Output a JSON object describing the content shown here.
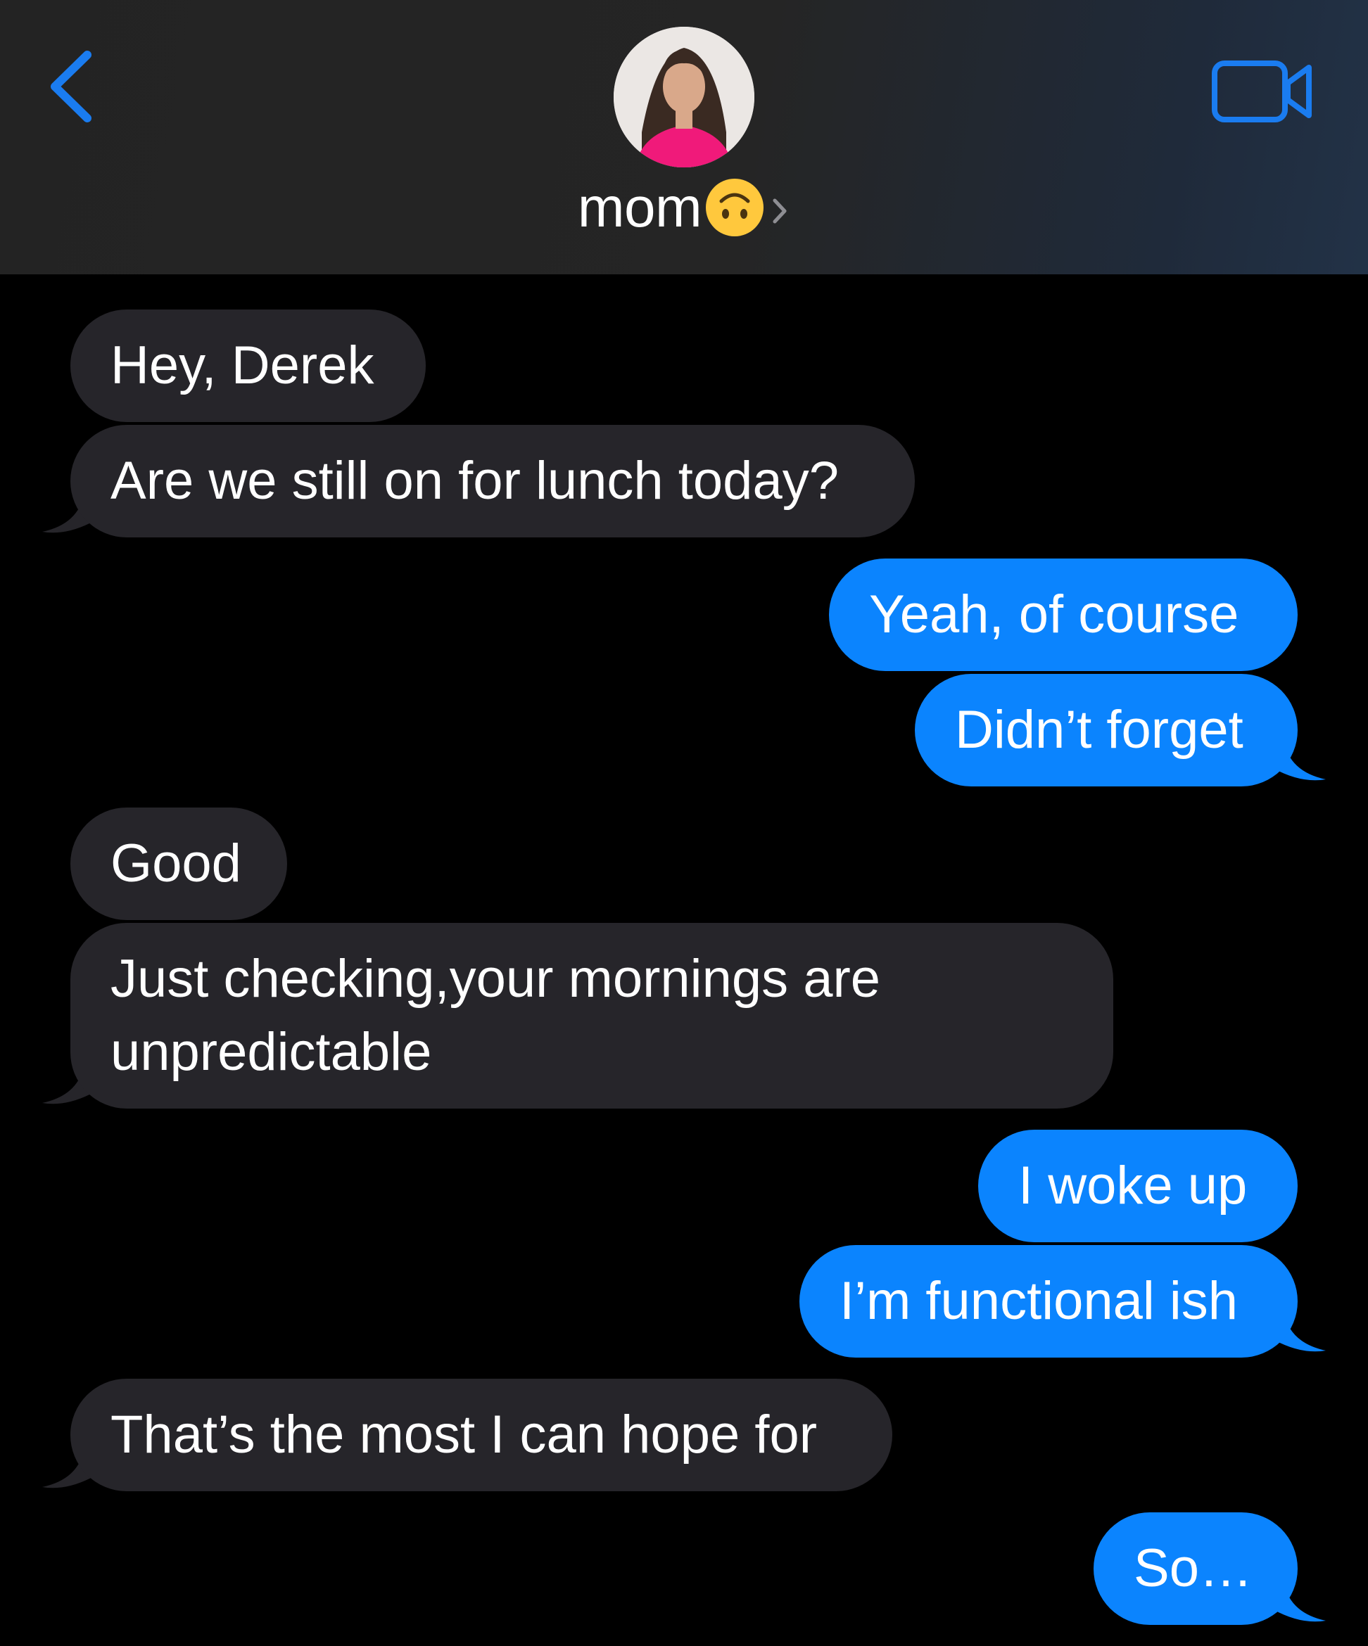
{
  "header": {
    "contact_name": "mom"
  },
  "messages": [
    {
      "side": "received",
      "text": "Hey, Derek"
    },
    {
      "side": "received",
      "text": "Are we still on for lunch today?"
    },
    {
      "side": "sent",
      "text": "Yeah, of course"
    },
    {
      "side": "sent",
      "text": "Didn’t forget"
    },
    {
      "side": "received",
      "text": "Good"
    },
    {
      "side": "received",
      "text": "Just checking,your mornings are unpredictable"
    },
    {
      "side": "sent",
      "text": "I woke up"
    },
    {
      "side": "sent",
      "text": "I’m functional ish"
    },
    {
      "side": "received",
      "text": "That’s the most I can hope for"
    },
    {
      "side": "sent",
      "text": "So…"
    }
  ],
  "colors": {
    "sent_bubble": "#0b84fe",
    "received_bubble": "#26252a",
    "accent": "#1a7cf0",
    "background": "#000000"
  },
  "icons": {
    "back": "chevron-left-icon",
    "video": "video-camera-icon",
    "contact_emoji": "upside-down-face-emoji-icon",
    "chevron": "chevron-right-icon"
  }
}
